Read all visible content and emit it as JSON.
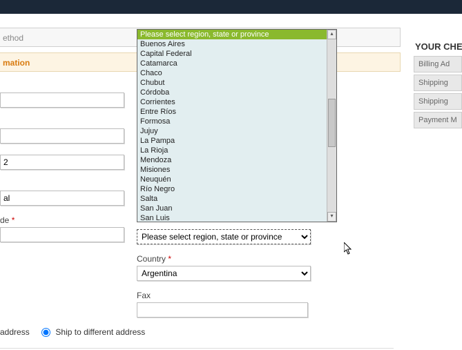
{
  "steps": {
    "method_label": "ethod",
    "active_label": "mation"
  },
  "form": {
    "left_value_0": "",
    "left_value_1": "",
    "left_value_2": "2",
    "left_value_3": "al",
    "zip_label_partial": "de",
    "zip_value": ""
  },
  "region": {
    "select_display": "Please select region, state or province",
    "options": [
      "Please select region, state or province",
      "Buenos Aires",
      "Capital Federal",
      "Catamarca",
      "Chaco",
      "Chubut",
      "Córdoba",
      "Corrientes",
      "Entre Ríos",
      "Formosa",
      "Jujuy",
      "La Pampa",
      "La Rioja",
      "Mendoza",
      "Misiones",
      "Neuquén",
      "Río Negro",
      "Salta",
      "San Juan",
      "San Luis"
    ]
  },
  "country": {
    "label": "Country",
    "value": "Argentina"
  },
  "fax": {
    "label": "Fax",
    "value": ""
  },
  "shipto": {
    "opt1": "address",
    "opt2": "Ship to different address"
  },
  "progress": {
    "title": "YOUR CHEC",
    "items": [
      "Billing Ad",
      "Shipping",
      "Shipping",
      "Payment M"
    ]
  }
}
